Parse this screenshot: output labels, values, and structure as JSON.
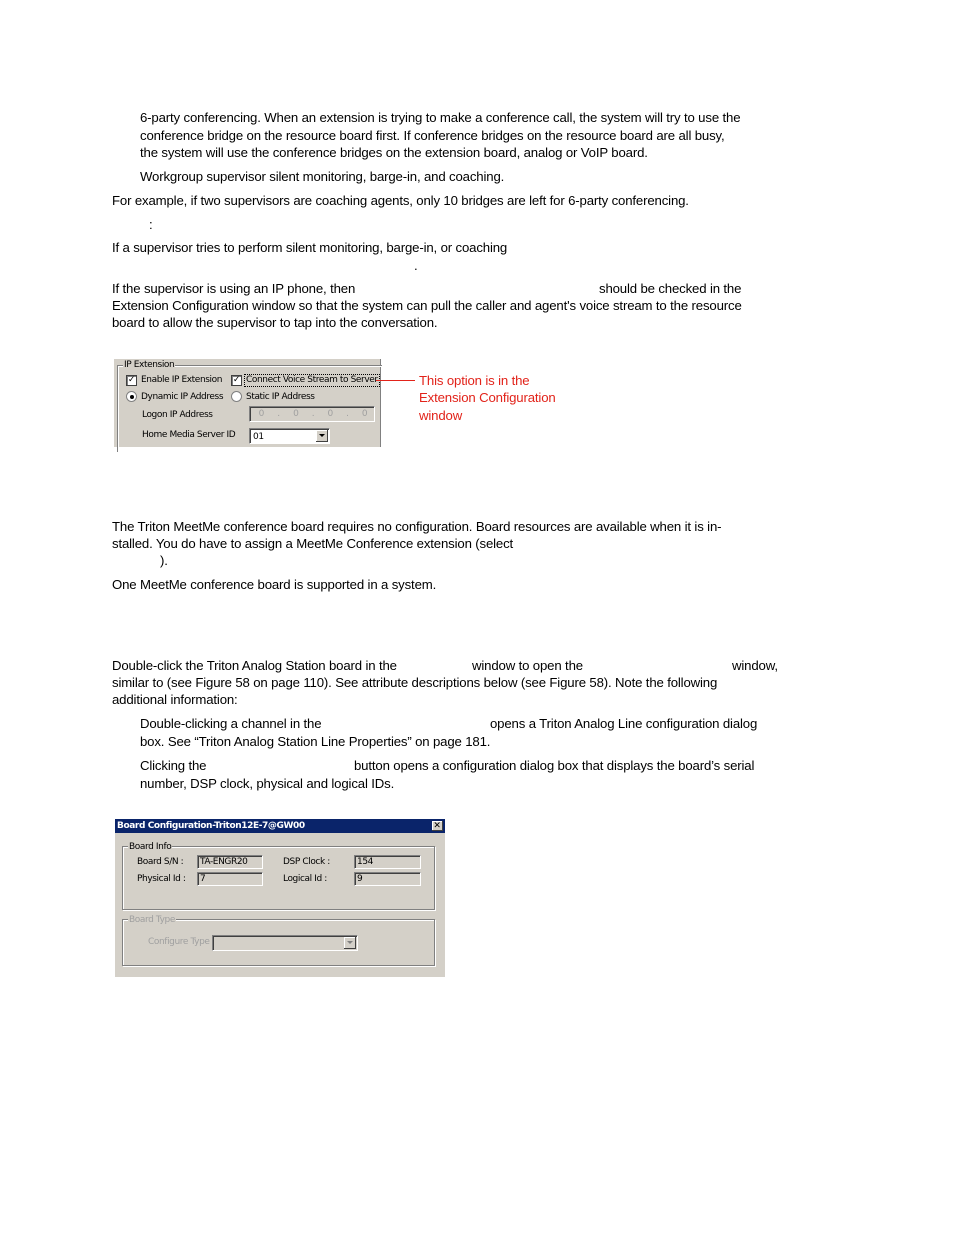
{
  "section1": {
    "bullet1_lines": [
      "6-party conferencing. When an extension is trying to make a conference call, the system will try to use the",
      "conference bridge on the resource board first. If conference bridges on the resource board are all busy,",
      "the system will use the conference bridges on the extension board, analog or VoIP board."
    ],
    "bullet2": "Workgroup supervisor silent monitoring, barge-in, and coaching.",
    "example": "For example, if two supervisors are coaching agents, only 10 bridges are left for 6-party conferencing.",
    "note_colon": ":",
    "note_line1": "If a supervisor tries to perform silent monitoring, barge-in, or coaching",
    "note_period": ".",
    "ip_para_line1_a": "If the supervisor is using an IP phone, then",
    "ip_para_line1_b": "should be checked in the",
    "ip_para_line2": "Extension Configuration window so that the system can pull the caller and agent's voice stream to the resource",
    "ip_para_line3": "board to allow the supervisor to tap into the conversation."
  },
  "ip_extension_dialog": {
    "group_label": "IP Extension",
    "enable_ip_extension": {
      "label": "Enable IP Extension",
      "checked": true
    },
    "connect_voice_stream": {
      "label": "Connect Voice Stream to Server",
      "checked": true
    },
    "dynamic_ip": {
      "label": "Dynamic IP Address",
      "selected": true
    },
    "static_ip": {
      "label": "Static IP Address",
      "selected": false
    },
    "logon_ip_label": "Logon IP Address",
    "logon_ip_octets": [
      "0",
      "0",
      "0",
      "0"
    ],
    "home_media_server_label": "Home Media Server ID",
    "home_media_server_value": "01"
  },
  "callout": {
    "lines": [
      "This option is in the",
      "Extension Configuration",
      "window"
    ],
    "color": "#e2231a"
  },
  "section2": {
    "meetme_line1": "The Triton MeetMe conference board requires no configuration. Board resources are available when it is in-",
    "meetme_line2": "stalled. You do have to assign a MeetMe Conference extension (select",
    "meetme_line3": ").",
    "meetme_support": "One MeetMe conference board is supported in a system."
  },
  "section3": {
    "para_line1_a": "Double-click the Triton Analog Station board in the",
    "para_line1_b": "window to open the",
    "para_line1_c": "window,",
    "para_line2": "similar to (see Figure 58 on page 110). See attribute descriptions below (see Figure 58). Note the following",
    "para_line3": "additional information:",
    "bullet1_a": "Double-clicking a channel in the",
    "bullet1_b": "opens a Triton Analog Line configuration dialog",
    "bullet1_line2": "box. See “Triton Analog Station Line Properties” on page 181.",
    "bullet2_a": "Clicking the",
    "bullet2_b": "button opens a configuration dialog box that displays the board’s serial",
    "bullet2_line2": "number, DSP clock, physical and logical IDs."
  },
  "board_config_dialog": {
    "title": "Board Configuration-Triton12E-7@GW00",
    "close_glyph": "✕",
    "board_info_label": "Board Info",
    "board_sn_label": "Board S/N :",
    "board_sn_value": "TA-ENGR20",
    "dsp_clock_label": "DSP Clock :",
    "dsp_clock_value": "154",
    "physical_id_label": "Physical Id :",
    "physical_id_value": "7",
    "logical_id_label": "Logical Id :",
    "logical_id_value": "9",
    "board_type_label": "Board Type",
    "configure_type_label": "Configure Type",
    "configure_type_value": ""
  }
}
